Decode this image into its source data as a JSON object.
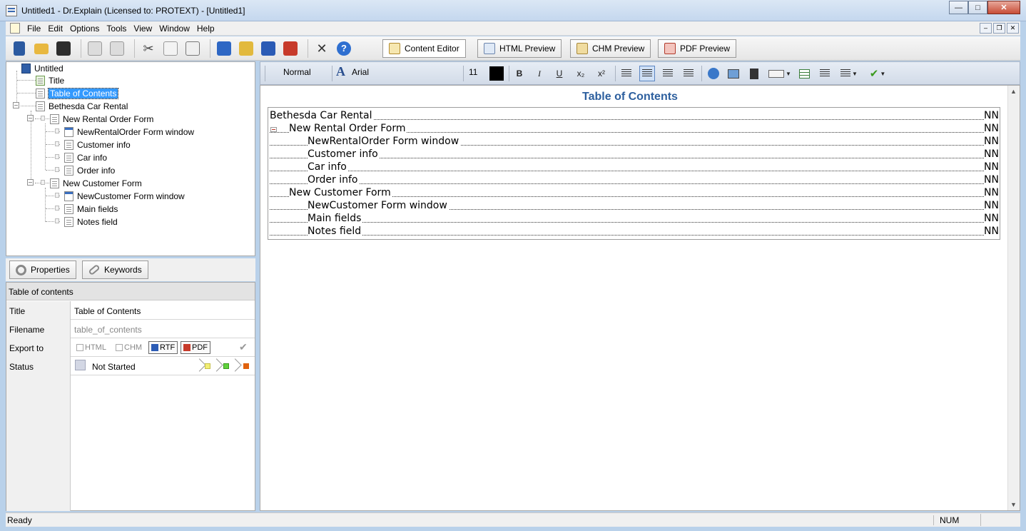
{
  "window": {
    "title": "Untitled1 - Dr.Explain (Licensed to: PROTEXT) - [Untitled1]",
    "min": "—",
    "max": "□",
    "close": "✕"
  },
  "menu": [
    "File",
    "Edit",
    "Options",
    "Tools",
    "View",
    "Window",
    "Help"
  ],
  "mdi": {
    "min": "–",
    "restore": "❐",
    "close": "✕"
  },
  "toolbar": {
    "tabs": [
      {
        "label": "Content Editor",
        "icon": "pencil-icon"
      },
      {
        "label": "HTML Preview",
        "icon": "html-preview-icon"
      },
      {
        "label": "CHM Preview",
        "icon": "chm-preview-icon"
      },
      {
        "label": "PDF Preview",
        "icon": "pdf-preview-icon"
      }
    ],
    "help": "?"
  },
  "tree": {
    "root": "Untitled",
    "nodes": [
      "Title",
      "Table of Contents",
      "Bethesda Car Rental",
      "New Rental Order Form",
      "NewRentalOrder Form window",
      "Customer info",
      "Car info",
      "Order info",
      "New Customer Form",
      "NewCustomer Form window",
      "Main fields",
      "Notes field"
    ]
  },
  "props": {
    "tabs": {
      "properties": "Properties",
      "keywords": "Keywords"
    },
    "header": "Table of contents",
    "title_key": "Title",
    "title_val": "Table of Contents",
    "filename_key": "Filename",
    "filename_val": "table_of_contents",
    "export_key": "Export to",
    "export": {
      "html": "HTML",
      "chm": "CHM",
      "rtf": "RTF",
      "pdf": "PDF"
    },
    "status_key": "Status",
    "status_val": "Not Started",
    "status_colors": [
      "#f2ee76",
      "#5fd13c",
      "#e0620e"
    ]
  },
  "editor_toolbar": {
    "style": "Normal",
    "font": "Arial",
    "size": "11",
    "bold": "B",
    "italic": "I",
    "underline": "U",
    "sub": "x₂",
    "sup": "x²",
    "font_color": "#000000"
  },
  "document": {
    "title": "Table of Contents",
    "entries": [
      {
        "text": "Bethesda Car Rental",
        "page": "NN"
      },
      {
        "text": "New Rental Order Form",
        "page": "NN"
      },
      {
        "text": "NewRentalOrder Form window",
        "page": "NN"
      },
      {
        "text": "Customer info",
        "page": "NN"
      },
      {
        "text": "Car info",
        "page": "NN"
      },
      {
        "text": "Order info",
        "page": "NN"
      },
      {
        "text": "New Customer Form",
        "page": "NN"
      },
      {
        "text": "NewCustomer Form window",
        "page": "NN"
      },
      {
        "text": "Main fields",
        "page": "NN"
      },
      {
        "text": "Notes field",
        "page": "NN"
      }
    ]
  },
  "statusbar": {
    "status": "Ready",
    "num": "NUM"
  }
}
